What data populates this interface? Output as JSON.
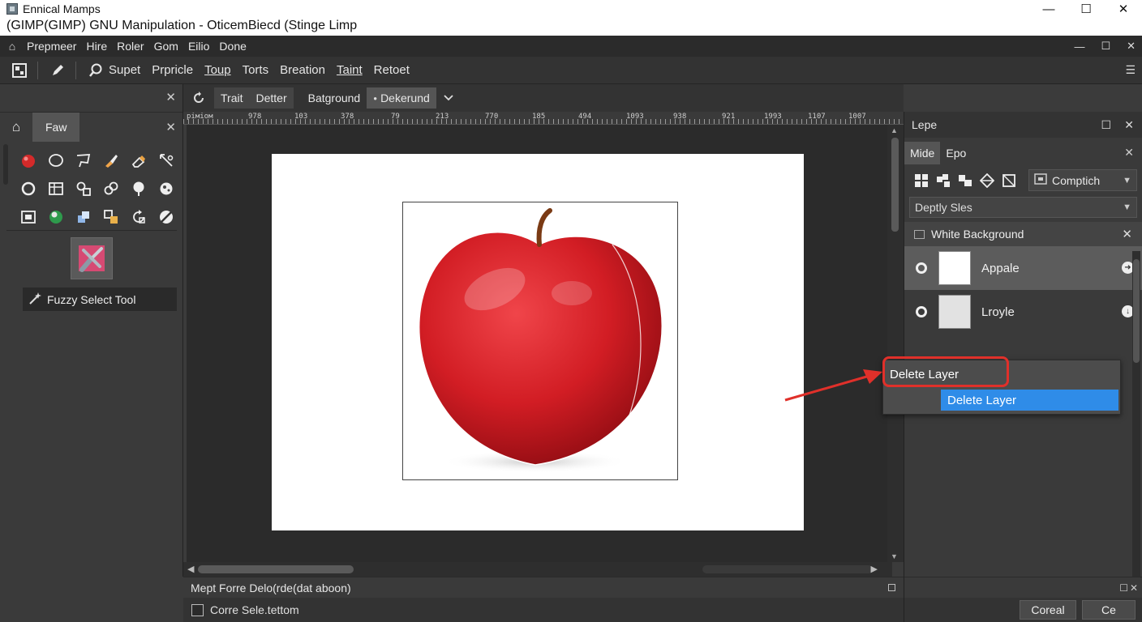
{
  "window": {
    "line1": "Ennical Mamps",
    "line2": "(GIMP(GIMP) GNU Manipulation - OticemBiecd (Stinge Limp",
    "minimize": "—",
    "maximize": "☐",
    "close": "✕"
  },
  "menubar": {
    "items": [
      "Prepmeer",
      "Hire",
      "Roler",
      "Gom",
      "Eilio",
      "Done"
    ],
    "controls": [
      "—",
      "☐",
      "✕"
    ]
  },
  "toolbar": {
    "items": [
      "Supet",
      "Prpricle",
      "Toup",
      "Torts",
      "Breation",
      "Taint",
      "Retoet"
    ]
  },
  "left_panel": {
    "tab": "Faw",
    "close": "✕",
    "active_tool_label": "Fuzzy Select Tool"
  },
  "canvas_tabs": {
    "tabs": [
      "Trait",
      "Detter"
    ],
    "dropdown_label": "Batground",
    "selected": "Dekerund"
  },
  "ruler": {
    "labels": [
      "ріміом",
      "978",
      "103",
      "378",
      "79",
      "213",
      "770",
      "185",
      "494",
      "1093",
      "938",
      "921",
      "1993",
      "1107",
      "1007"
    ]
  },
  "status": {
    "message": "Mept Forre Delo(rde(​dat aboon)",
    "checkbox_label": "Corre Sele.tettom"
  },
  "right_panel": {
    "header": "Lepe",
    "tabs": [
      "Mide",
      "Epo"
    ],
    "mode": "Comptich",
    "opacity": "Deptly Sles",
    "group": "White Background",
    "layers": [
      {
        "name": "Appale",
        "selected": true
      },
      {
        "name": "Lroyle",
        "selected": false
      }
    ],
    "buttons": [
      "Coreal",
      "Ce"
    ]
  },
  "context_menu": {
    "item1": "Delete Layer",
    "item2": "Delete Layer"
  },
  "colors": {
    "highlight": "#e0302a",
    "menu_selection": "#2f8ce8",
    "apple_red": "#d8232a"
  }
}
